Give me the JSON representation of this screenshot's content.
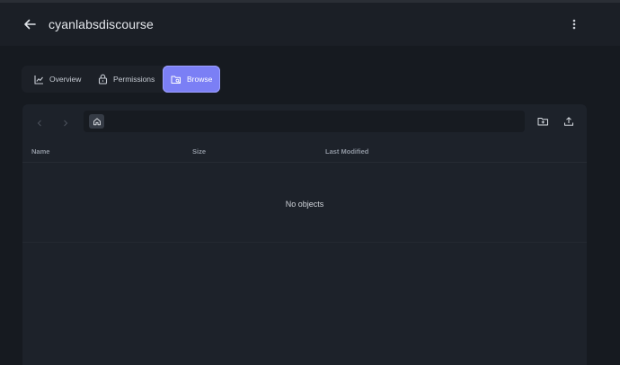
{
  "header": {
    "title": "cyanlabsdiscourse",
    "back_icon": "arrow-left-icon",
    "menu_icon": "more-vertical-icon"
  },
  "tabs": [
    {
      "label": "Overview",
      "icon": "chart-line-icon",
      "active": false
    },
    {
      "label": "Permissions",
      "icon": "lock-icon",
      "active": false
    },
    {
      "label": "Browse",
      "icon": "folder-search-icon",
      "active": true
    }
  ],
  "browser": {
    "path_root_icon": "home-icon",
    "actions": [
      "new-folder-icon",
      "upload-icon"
    ],
    "columns": [
      "Name",
      "Size",
      "Last Modified"
    ],
    "empty_message": "No objects"
  },
  "colors": {
    "background": "#161a20",
    "header": "#1b1f26",
    "panel": "#1d222a",
    "accent": "#7b7ff5"
  }
}
